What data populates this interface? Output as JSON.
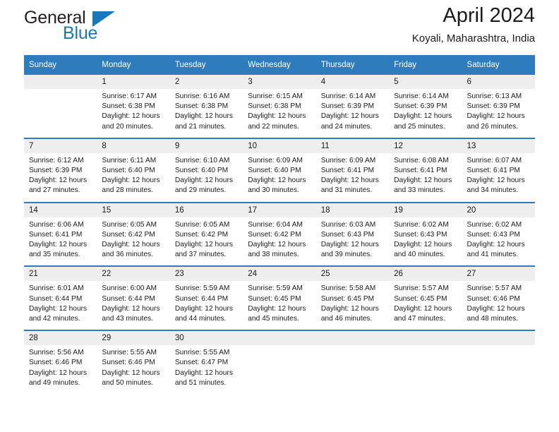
{
  "brand": {
    "name_part1": "General",
    "name_part2": "Blue",
    "logo_icon": "triangle-logo-icon"
  },
  "header": {
    "title": "April 2024",
    "location": "Koyali, Maharashtra, India"
  },
  "calendar": {
    "weekday_headers": [
      "Sunday",
      "Monday",
      "Tuesday",
      "Wednesday",
      "Thursday",
      "Friday",
      "Saturday"
    ],
    "accent_color": "#2e7cbe",
    "daynum_band_color": "#eeeeee",
    "labels": {
      "sunrise": "Sunrise:",
      "sunset": "Sunset:",
      "daylight": "Daylight:"
    },
    "weeks": [
      [
        {
          "day": "",
          "empty": true
        },
        {
          "day": "1",
          "sunrise": "Sunrise: 6:17 AM",
          "sunset": "Sunset: 6:38 PM",
          "daylight": "Daylight: 12 hours and 20 minutes."
        },
        {
          "day": "2",
          "sunrise": "Sunrise: 6:16 AM",
          "sunset": "Sunset: 6:38 PM",
          "daylight": "Daylight: 12 hours and 21 minutes."
        },
        {
          "day": "3",
          "sunrise": "Sunrise: 6:15 AM",
          "sunset": "Sunset: 6:38 PM",
          "daylight": "Daylight: 12 hours and 22 minutes."
        },
        {
          "day": "4",
          "sunrise": "Sunrise: 6:14 AM",
          "sunset": "Sunset: 6:39 PM",
          "daylight": "Daylight: 12 hours and 24 minutes."
        },
        {
          "day": "5",
          "sunrise": "Sunrise: 6:14 AM",
          "sunset": "Sunset: 6:39 PM",
          "daylight": "Daylight: 12 hours and 25 minutes."
        },
        {
          "day": "6",
          "sunrise": "Sunrise: 6:13 AM",
          "sunset": "Sunset: 6:39 PM",
          "daylight": "Daylight: 12 hours and 26 minutes."
        }
      ],
      [
        {
          "day": "7",
          "sunrise": "Sunrise: 6:12 AM",
          "sunset": "Sunset: 6:39 PM",
          "daylight": "Daylight: 12 hours and 27 minutes."
        },
        {
          "day": "8",
          "sunrise": "Sunrise: 6:11 AM",
          "sunset": "Sunset: 6:40 PM",
          "daylight": "Daylight: 12 hours and 28 minutes."
        },
        {
          "day": "9",
          "sunrise": "Sunrise: 6:10 AM",
          "sunset": "Sunset: 6:40 PM",
          "daylight": "Daylight: 12 hours and 29 minutes."
        },
        {
          "day": "10",
          "sunrise": "Sunrise: 6:09 AM",
          "sunset": "Sunset: 6:40 PM",
          "daylight": "Daylight: 12 hours and 30 minutes."
        },
        {
          "day": "11",
          "sunrise": "Sunrise: 6:09 AM",
          "sunset": "Sunset: 6:41 PM",
          "daylight": "Daylight: 12 hours and 31 minutes."
        },
        {
          "day": "12",
          "sunrise": "Sunrise: 6:08 AM",
          "sunset": "Sunset: 6:41 PM",
          "daylight": "Daylight: 12 hours and 33 minutes."
        },
        {
          "day": "13",
          "sunrise": "Sunrise: 6:07 AM",
          "sunset": "Sunset: 6:41 PM",
          "daylight": "Daylight: 12 hours and 34 minutes."
        }
      ],
      [
        {
          "day": "14",
          "sunrise": "Sunrise: 6:06 AM",
          "sunset": "Sunset: 6:41 PM",
          "daylight": "Daylight: 12 hours and 35 minutes."
        },
        {
          "day": "15",
          "sunrise": "Sunrise: 6:05 AM",
          "sunset": "Sunset: 6:42 PM",
          "daylight": "Daylight: 12 hours and 36 minutes."
        },
        {
          "day": "16",
          "sunrise": "Sunrise: 6:05 AM",
          "sunset": "Sunset: 6:42 PM",
          "daylight": "Daylight: 12 hours and 37 minutes."
        },
        {
          "day": "17",
          "sunrise": "Sunrise: 6:04 AM",
          "sunset": "Sunset: 6:42 PM",
          "daylight": "Daylight: 12 hours and 38 minutes."
        },
        {
          "day": "18",
          "sunrise": "Sunrise: 6:03 AM",
          "sunset": "Sunset: 6:43 PM",
          "daylight": "Daylight: 12 hours and 39 minutes."
        },
        {
          "day": "19",
          "sunrise": "Sunrise: 6:02 AM",
          "sunset": "Sunset: 6:43 PM",
          "daylight": "Daylight: 12 hours and 40 minutes."
        },
        {
          "day": "20",
          "sunrise": "Sunrise: 6:02 AM",
          "sunset": "Sunset: 6:43 PM",
          "daylight": "Daylight: 12 hours and 41 minutes."
        }
      ],
      [
        {
          "day": "21",
          "sunrise": "Sunrise: 6:01 AM",
          "sunset": "Sunset: 6:44 PM",
          "daylight": "Daylight: 12 hours and 42 minutes."
        },
        {
          "day": "22",
          "sunrise": "Sunrise: 6:00 AM",
          "sunset": "Sunset: 6:44 PM",
          "daylight": "Daylight: 12 hours and 43 minutes."
        },
        {
          "day": "23",
          "sunrise": "Sunrise: 5:59 AM",
          "sunset": "Sunset: 6:44 PM",
          "daylight": "Daylight: 12 hours and 44 minutes."
        },
        {
          "day": "24",
          "sunrise": "Sunrise: 5:59 AM",
          "sunset": "Sunset: 6:45 PM",
          "daylight": "Daylight: 12 hours and 45 minutes."
        },
        {
          "day": "25",
          "sunrise": "Sunrise: 5:58 AM",
          "sunset": "Sunset: 6:45 PM",
          "daylight": "Daylight: 12 hours and 46 minutes."
        },
        {
          "day": "26",
          "sunrise": "Sunrise: 5:57 AM",
          "sunset": "Sunset: 6:45 PM",
          "daylight": "Daylight: 12 hours and 47 minutes."
        },
        {
          "day": "27",
          "sunrise": "Sunrise: 5:57 AM",
          "sunset": "Sunset: 6:46 PM",
          "daylight": "Daylight: 12 hours and 48 minutes."
        }
      ],
      [
        {
          "day": "28",
          "sunrise": "Sunrise: 5:56 AM",
          "sunset": "Sunset: 6:46 PM",
          "daylight": "Daylight: 12 hours and 49 minutes."
        },
        {
          "day": "29",
          "sunrise": "Sunrise: 5:55 AM",
          "sunset": "Sunset: 6:46 PM",
          "daylight": "Daylight: 12 hours and 50 minutes."
        },
        {
          "day": "30",
          "sunrise": "Sunrise: 5:55 AM",
          "sunset": "Sunset: 6:47 PM",
          "daylight": "Daylight: 12 hours and 51 minutes."
        },
        {
          "day": "",
          "empty": true
        },
        {
          "day": "",
          "empty": true
        },
        {
          "day": "",
          "empty": true
        },
        {
          "day": "",
          "empty": true
        }
      ]
    ]
  }
}
